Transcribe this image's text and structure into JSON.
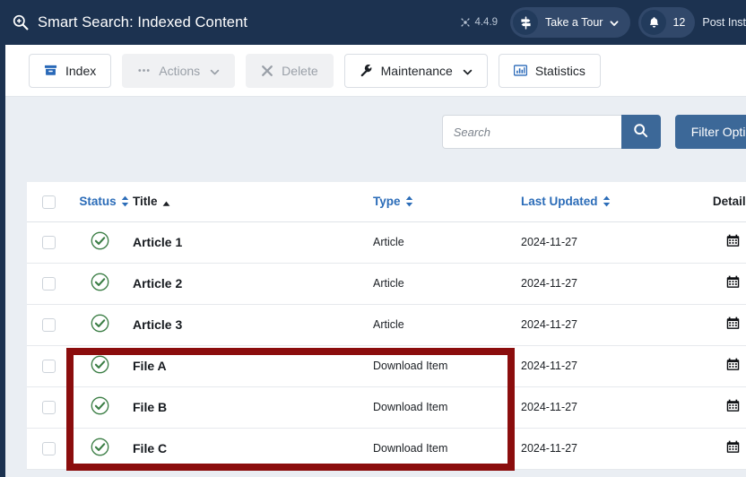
{
  "header": {
    "title": "Smart Search: Indexed Content",
    "title_icon": "search-plus-icon",
    "version_label": "4.4.9",
    "version_icon": "joomla-logo-icon",
    "tour_label": "Take a Tour",
    "tour_icon": "signpost-icon",
    "tour_caret_icon": "chevron-down-icon",
    "notifications_count": "12",
    "notifications_icon": "bell-icon",
    "post_install_label": "Post Inst"
  },
  "toolbar": {
    "buttons": [
      {
        "label": "Index",
        "icon": "archive-box-icon",
        "state": "enabled",
        "has_caret": false
      },
      {
        "label": "Actions",
        "icon": "ellipsis-icon",
        "state": "disabled",
        "has_caret": true
      },
      {
        "label": "Delete",
        "icon": "x-icon",
        "state": "disabled",
        "has_caret": false
      },
      {
        "label": "Maintenance",
        "icon": "wrench-icon",
        "state": "enabled",
        "has_caret": true
      },
      {
        "label": "Statistics",
        "icon": "bar-chart-icon",
        "state": "enabled",
        "has_caret": false
      }
    ]
  },
  "filters": {
    "search_value": "",
    "search_placeholder": "Search",
    "search_button_icon": "magnifier-icon",
    "filter_options_label": "Filter Options"
  },
  "table": {
    "select_all_checkbox": "unchecked",
    "columns": [
      {
        "label": "Status",
        "sortable": true,
        "sorted": "none",
        "style": "link"
      },
      {
        "label": "Title",
        "sortable": true,
        "sorted": "asc",
        "style": "plain"
      },
      {
        "label": "Type",
        "sortable": true,
        "sorted": "none",
        "style": "link"
      },
      {
        "label": "Last Updated",
        "sortable": true,
        "sorted": "none",
        "style": "link"
      },
      {
        "label": "Details",
        "sortable": false,
        "sorted": "none",
        "style": "plain"
      }
    ],
    "rows": [
      {
        "checkbox": "unchecked",
        "status_icon": "check-circle-icon",
        "title": "Article 1",
        "type": "Article",
        "last_updated": "2024-11-27",
        "details_icon": "calendar-icon"
      },
      {
        "checkbox": "unchecked",
        "status_icon": "check-circle-icon",
        "title": "Article 2",
        "type": "Article",
        "last_updated": "2024-11-27",
        "details_icon": "calendar-icon"
      },
      {
        "checkbox": "unchecked",
        "status_icon": "check-circle-icon",
        "title": "Article 3",
        "type": "Article",
        "last_updated": "2024-11-27",
        "details_icon": "calendar-icon"
      },
      {
        "checkbox": "unchecked",
        "status_icon": "check-circle-icon",
        "title": "File A",
        "type": "Download Item",
        "last_updated": "2024-11-27",
        "details_icon": "calendar-icon"
      },
      {
        "checkbox": "unchecked",
        "status_icon": "check-circle-icon",
        "title": "File B",
        "type": "Download Item",
        "last_updated": "2024-11-27",
        "details_icon": "calendar-icon"
      },
      {
        "checkbox": "unchecked",
        "status_icon": "check-circle-icon",
        "title": "File C",
        "type": "Download Item",
        "last_updated": "2024-11-27",
        "details_icon": "calendar-icon"
      }
    ]
  },
  "annotation": {
    "shape": "rectangle",
    "color": "#8b0d0d",
    "highlights": "File A, File B, File C rows"
  },
  "colors": {
    "header_bg": "#1c3250",
    "accent_blue": "#3c6898",
    "link_blue": "#2b6cb8",
    "status_green": "#3a7d44",
    "annotation_red": "#8b0d0d",
    "content_bg": "#eaeef3"
  }
}
